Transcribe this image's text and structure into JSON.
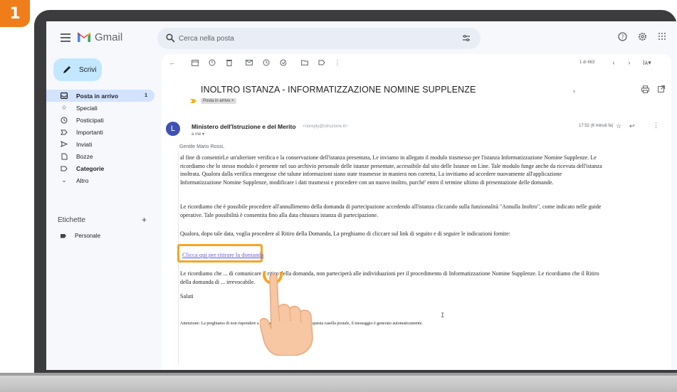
{
  "step_number": "1",
  "app": {
    "name": "Gmail"
  },
  "search": {
    "placeholder": "Cerca nella posta"
  },
  "sidebar": {
    "compose_label": "Scrivi",
    "items": [
      {
        "label": "Posta in arrivo",
        "count": "1",
        "icon": "inbox-icon",
        "active": true
      },
      {
        "label": "Speciali",
        "icon": "star-icon"
      },
      {
        "label": "Posticipati",
        "icon": "clock-icon"
      },
      {
        "label": "Importanti",
        "icon": "important-icon"
      },
      {
        "label": "Inviati",
        "icon": "send-icon"
      },
      {
        "label": "Bozze",
        "icon": "draft-icon"
      },
      {
        "label": "Categorie",
        "icon": "label-icon"
      },
      {
        "label": "Altro",
        "icon": "chevron-down-icon"
      }
    ],
    "labels_title": "Etichette",
    "labels": [
      {
        "label": "Personale"
      }
    ]
  },
  "toolbar": {
    "pager": "1 di 663"
  },
  "message": {
    "subject": "INOLTRO ISTANZA - INFORMATIZZAZIONE NOMINE SUPPLENZE",
    "tag": "Posta in arrivo ×",
    "avatar_letter": "L",
    "sender": "Ministero dell'Istruzione e del Merito",
    "sender_email": "<noreply@istruzione.it>",
    "to": "a me ▾",
    "time": "17:52 (6 minuti fa)",
    "greeting": "Gentile Mario Rossi,",
    "p1": "al fine di consentirLe un'ulteriore verifica e la conservazione dell'istanza presentata, Le inviamo in allegato il modulo trasmesso per l'istanza Informatizzazione Nomine Supplenze. Le ricordiamo che lo stesso modulo è presente nel suo archivio personale delle istanze presentate, accessibile dal sito delle Istanze on Line. Tale modulo funge anche da ricevuta dell'istanza inoltrata. Qualora dalla verifica emergesse che talune informazioni siano state trasmesse in maniera non corretta, La invitiamo ad accedere nuovamente all'applicazione Informatizzazione Nomine Supplenze, modificare i dati trasmessi e procedere con un nuovo inoltro, purché' entro il termine ultimo di presentazione delle domande.",
    "p2": "Le ricordiamo che è possibile procedere all'annullimento della domanda di partecipazione accedendo all'istanza cliccando sulla funzionalità \"Annulla Inoltro\", come indicato nelle guide operative. Tale possibilità è consentita fino alla data chiusura istanza di partecipazione.",
    "p3": "Qualora, dopo tale data, voglia procedere al Ritiro della Domanda, La preghiamo di cliccare sul link di seguito e di seguire le indicazioni fornite:",
    "link": "Clicca qui per ritirare la domanda",
    "p4": "Le ricordiamo che ... di comunicare il ritiro della domanda, non parteciperà alle individuazioni per il procedimento di Informatizzazione Nomine Supplenze. Le ricordiamo che il Ritiro della domanda di ... irrevocabile.",
    "p5": "Saluti",
    "p6": "Attenzione: La preghiamo di non rispondere a questa mail e di non utilizzare questa casella postale, il messaggio è generato automaticamente."
  },
  "colors": {
    "accent": "#ee7d1a",
    "highlight": "#f5a623",
    "compose": "#c2e7ff",
    "active_nav": "#d3e3fd"
  }
}
